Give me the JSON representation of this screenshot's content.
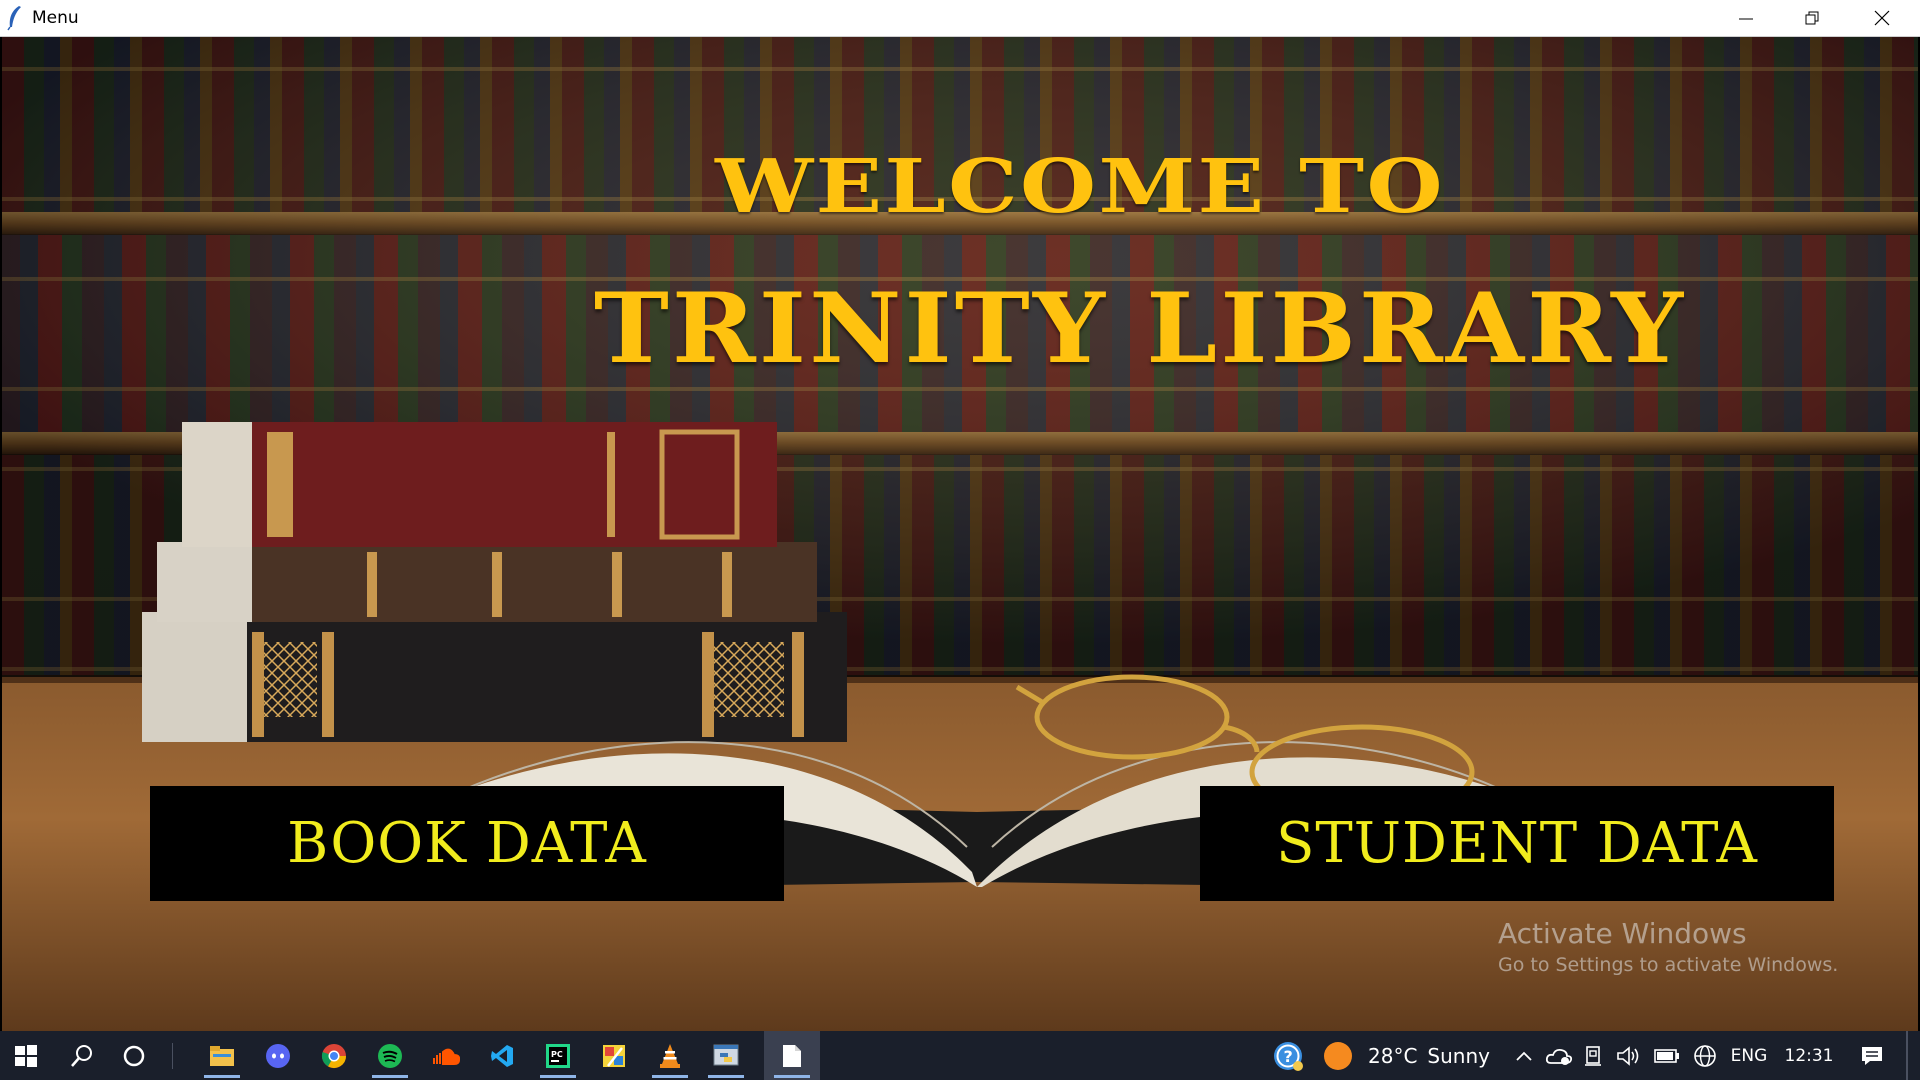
{
  "window": {
    "title": "Menu",
    "controls": [
      "minimize",
      "restore",
      "close"
    ]
  },
  "hero": {
    "line1": "WELCOME TO",
    "line2": "TRINITY LIBRARY"
  },
  "buttons": {
    "book": "BOOK DATA",
    "student": "STUDENT DATA"
  },
  "watermark": {
    "line1": "Activate Windows",
    "line2": "Go to Settings to activate Windows."
  },
  "taskbar": {
    "apps": [
      "start-icon",
      "search-icon",
      "cortana-icon",
      "file-explorer-icon",
      "discord-icon",
      "chrome-icon",
      "spotify-icon",
      "soundcloud-icon",
      "vscode-icon",
      "pycharm-icon",
      "paint-icon",
      "vlc-icon",
      "python-idle-icon",
      "notepad-icon"
    ],
    "weather": {
      "temp": "28°C",
      "condition": "Sunny"
    },
    "language": "ENG",
    "time": "12:31"
  },
  "colors": {
    "title_gold": "#ffc20f",
    "button_text": "#f1ec1d",
    "button_bg": "#000000",
    "taskbar_bg": "#1a1f2b"
  }
}
